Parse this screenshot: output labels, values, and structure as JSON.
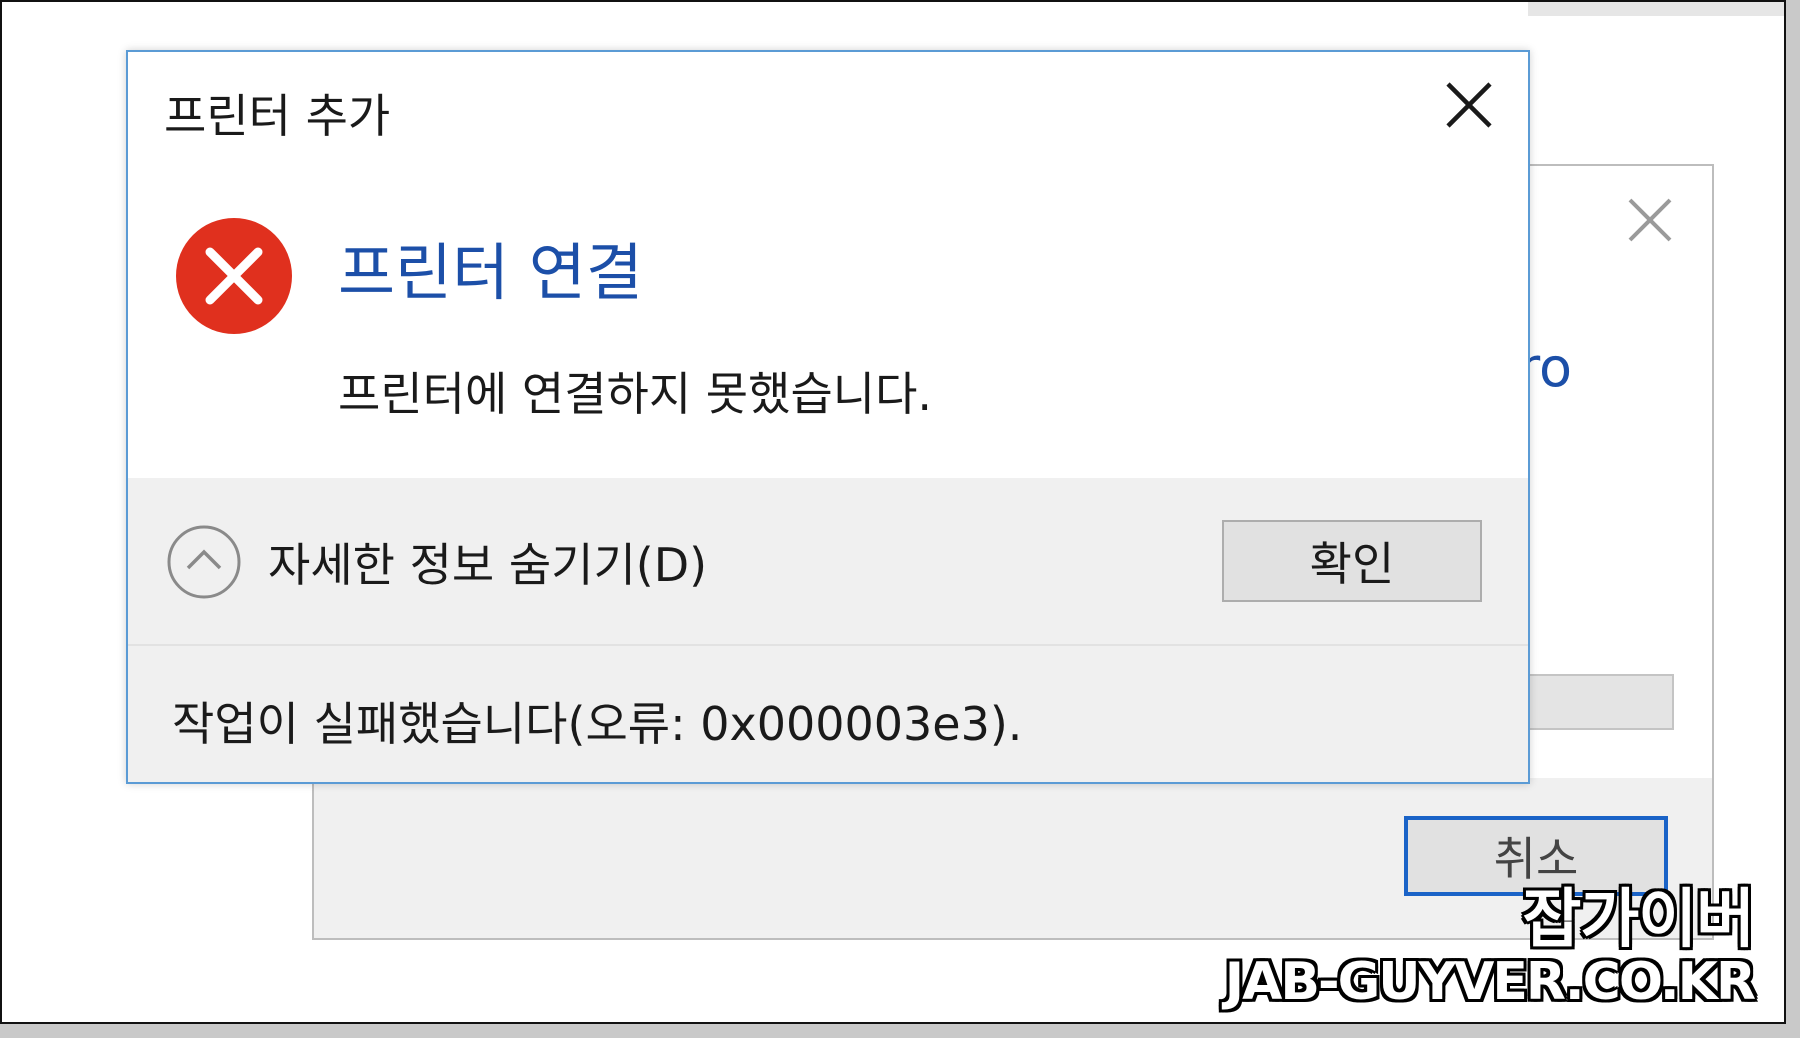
{
  "background_dialog": {
    "title_fragment": "ro",
    "cancel_label": "취소"
  },
  "dialog": {
    "title": "프린터 추가",
    "heading": "프린터 연결",
    "message": "프린터에 연결하지 못했습니다.",
    "details_toggle_label": "자세한 정보 숨기기(D)",
    "ok_label": "확인",
    "error_detail": "작업이 실패했습니다(오류: 0x000003e3)."
  },
  "watermark": {
    "name": "잡가이버",
    "url": "JAB-GUYVER.CO.KR"
  },
  "colors": {
    "heading_blue": "#1c4fa8",
    "error_red": "#e0301e",
    "dialog_border": "#5b9bd5",
    "button_focus_border": "#1a63c7"
  },
  "icons": [
    "close-icon",
    "error-icon",
    "chevron-up-icon"
  ]
}
